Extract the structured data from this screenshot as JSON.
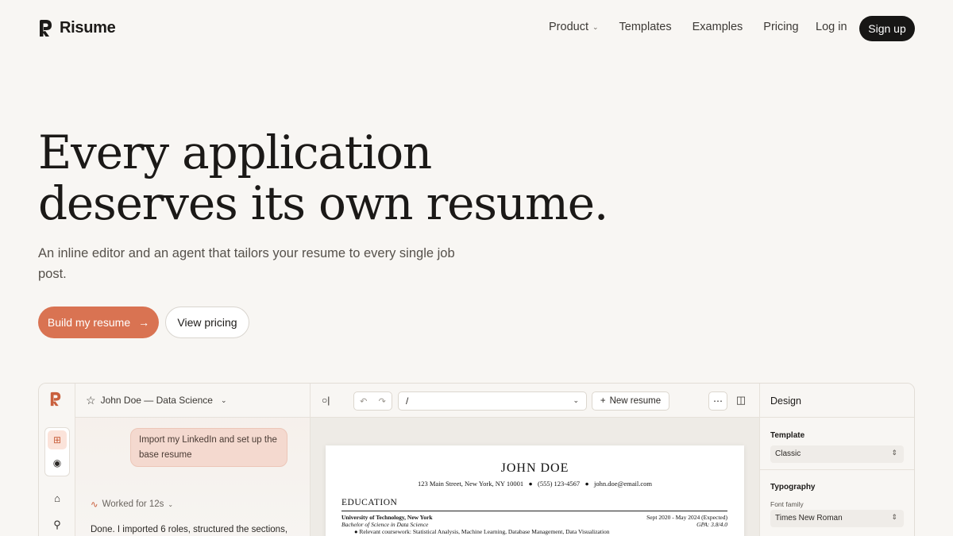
{
  "brand": {
    "name": "Risume",
    "accent": "#d97352",
    "dark": "#171615"
  },
  "nav": {
    "items": [
      {
        "label": "Product",
        "has_dropdown": true
      },
      {
        "label": "Templates"
      },
      {
        "label": "Examples"
      },
      {
        "label": "Pricing"
      }
    ],
    "login": "Log in",
    "signup": "Sign up"
  },
  "hero": {
    "title_line1": "Every application",
    "title_line2": "deserves its own resume.",
    "subtitle": "An inline editor and an agent that tailors your resume to every single job post.",
    "primary_cta": "Build my resume",
    "secondary_cta": "View pricing"
  },
  "app": {
    "chat": {
      "document_title": "John Doe — Data Science",
      "user_message": "Import my LinkedIn and set up the base resume",
      "worked_for": "Worked for 12s",
      "reply": "Done. I imported 6 roles, structured the sections,"
    },
    "toolbar": {
      "path": "/",
      "new_resume": "New resume"
    },
    "resume": {
      "name": "JOHN DOE",
      "contact": [
        "123 Main Street, New York, NY 10001",
        "(555) 123-4567",
        "john.doe@email.com"
      ],
      "section_title": "EDUCATION",
      "school": "University of Technology, New York",
      "dates": "Sept 2020 - May 2024 (Expected)",
      "degree": "Bachelor of Science in Data Science",
      "gpa": "GPA: 3.8/4.0",
      "coursework": "Relevant coursework: Statistical Analysis, Machine Learning, Database Management, Data Visualization"
    },
    "design": {
      "title": "Design",
      "template_label": "Template",
      "template_value": "Classic",
      "typography_label": "Typography",
      "font_family_label": "Font family",
      "font_family_value": "Times New Roman"
    }
  }
}
